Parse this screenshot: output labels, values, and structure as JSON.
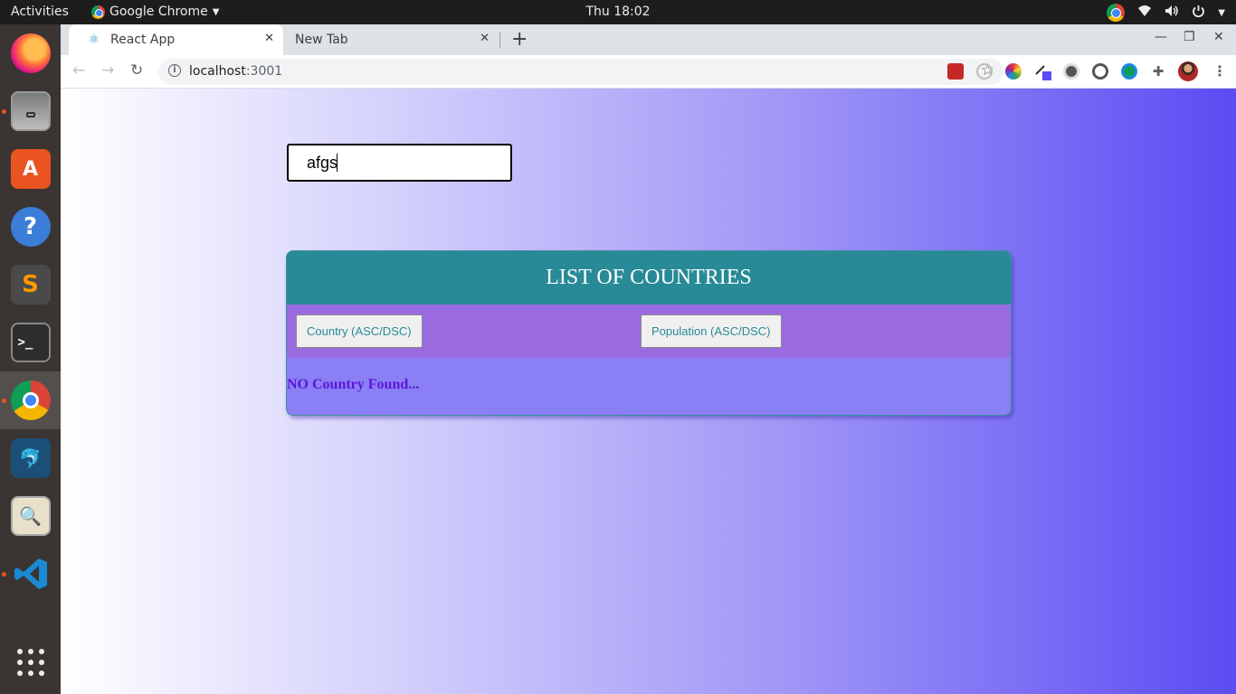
{
  "topbar": {
    "activities": "Activities",
    "app_name": "Google Chrome",
    "clock": "Thu 18:02"
  },
  "dock": {
    "items": [
      "firefox",
      "files",
      "software-center",
      "help",
      "sublime-text",
      "terminal",
      "chrome",
      "mysql-workbench",
      "image-viewer",
      "vscode",
      "show-applications"
    ]
  },
  "browser": {
    "tabs": [
      {
        "label": "React App",
        "active": true
      },
      {
        "label": "New Tab",
        "active": false
      }
    ],
    "url_host": "localhost",
    "url_port": ":3001"
  },
  "page": {
    "search_value": "afgs",
    "table_title": "LIST OF COUNTRIES",
    "sort_country_label": "Country (ASC/DSC)",
    "sort_population_label": "Population (ASC/DSC)",
    "empty_message": "NO Country Found..."
  },
  "colors": {
    "header_teal": "#288a96",
    "sort_bar_purple": "#9a6be0",
    "empty_text": "#5c16d6",
    "gradient_end": "#5b4cf3"
  }
}
